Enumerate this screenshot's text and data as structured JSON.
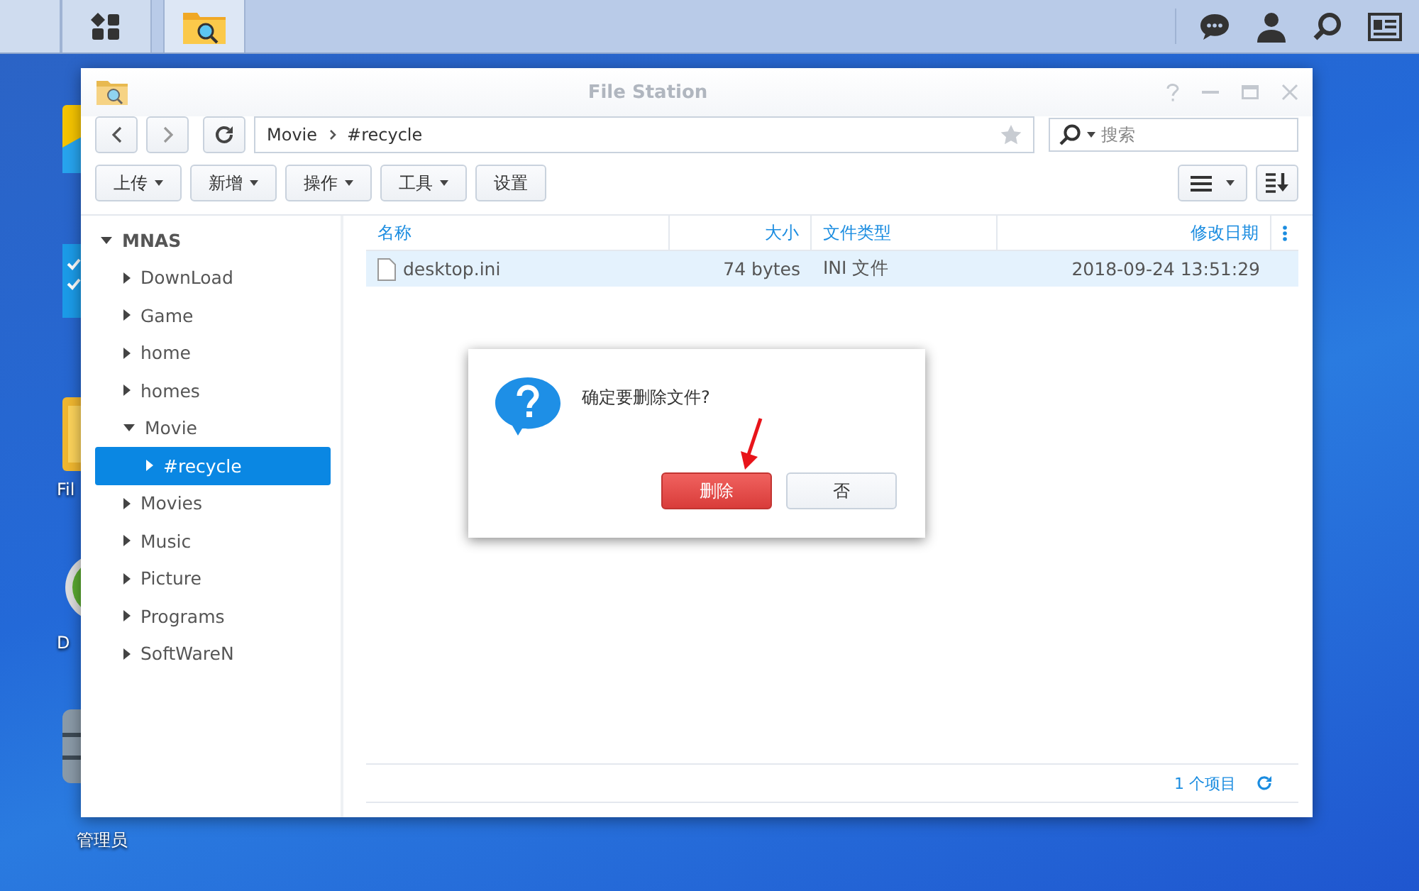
{
  "desktop": {
    "icons": [
      {
        "kind": "bag"
      },
      {
        "kind": "checklist"
      },
      {
        "kind": "folder",
        "label": "Fil"
      },
      {
        "kind": "disc",
        "label": "D"
      },
      {
        "kind": "database",
        "label": "管理员"
      }
    ]
  },
  "window": {
    "title": "File Station",
    "path": [
      "Movie",
      "#recycle"
    ],
    "search": {
      "placeholder": "搜索"
    },
    "toolbar": [
      {
        "label": "上传",
        "dropdown": true
      },
      {
        "label": "新增",
        "dropdown": true
      },
      {
        "label": "操作",
        "dropdown": true
      },
      {
        "label": "工具",
        "dropdown": true
      },
      {
        "label": "设置",
        "dropdown": false
      }
    ],
    "tree": {
      "label": "MNAS",
      "expanded": true,
      "children": [
        {
          "label": "DownLoad",
          "expanded": false,
          "selected": false
        },
        {
          "label": "Game",
          "expanded": false,
          "selected": false
        },
        {
          "label": "home",
          "expanded": false,
          "selected": false
        },
        {
          "label": "homes",
          "expanded": false,
          "selected": false
        },
        {
          "label": "Movie",
          "expanded": true,
          "selected": false,
          "children": [
            {
              "label": "#recycle",
              "expanded": false,
              "selected": true
            }
          ]
        },
        {
          "label": "Movies",
          "expanded": false,
          "selected": false
        },
        {
          "label": "Music",
          "expanded": false,
          "selected": false
        },
        {
          "label": "Picture",
          "expanded": false,
          "selected": false
        },
        {
          "label": "Programs",
          "expanded": false,
          "selected": false
        },
        {
          "label": "SoftWareN",
          "expanded": false,
          "selected": false
        }
      ]
    },
    "table": {
      "columns": [
        "名称",
        "大小",
        "文件类型",
        "修改日期"
      ],
      "rows": [
        {
          "name": "desktop.ini",
          "size": "74 bytes",
          "type": "INI 文件",
          "modified": "2018-09-24 13:51:29",
          "selected": true
        }
      ]
    },
    "status_bar": {
      "count": "1 个项目"
    }
  },
  "dialog": {
    "message": "确定要删除文件?",
    "buttons": [
      {
        "label": "删除",
        "kind": "danger"
      },
      {
        "label": "否",
        "kind": "normal"
      }
    ]
  }
}
